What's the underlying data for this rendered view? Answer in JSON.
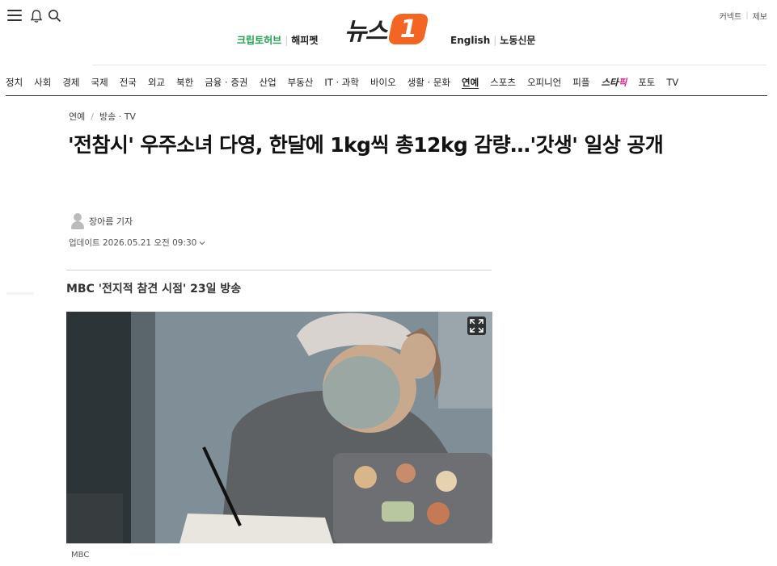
{
  "header": {
    "logo_text": "뉴스",
    "logo_badge": "1",
    "left_links": [
      "크립토허브",
      "해피펫"
    ],
    "right_links": [
      "English",
      "노동신문"
    ],
    "util_links": [
      "커넥트",
      "제보"
    ]
  },
  "gnb": {
    "items": [
      "정치",
      "사회",
      "경제",
      "국제",
      "전국",
      "외교",
      "북한",
      "금융 · 증권",
      "산업",
      "부동산",
      "IT · 과학",
      "바이오",
      "생활 · 문화",
      "연예",
      "스포츠",
      "오피니언",
      "피플",
      "스타픽",
      "포토",
      "TV"
    ],
    "active": "연예",
    "star_item": {
      "prefix": "스타",
      "suffix": "픽"
    }
  },
  "article": {
    "breadcrumb": [
      "연예",
      "방송 · TV"
    ],
    "headline": "'전참시' 우주소녀 다영, 한달에 1kg씩 총12kg 감량…'갓생' 일상 공개",
    "reporter": "장아름 기자",
    "updated": "업데이트 2026.05.21 오전 09:30",
    "subtitle": "MBC '전지적 참견 시점' 23일 방송",
    "photo_caption": "MBC"
  },
  "colors": {
    "brand_orange": "#f26522",
    "green_link": "#21a04a",
    "star_pink": "#e91e8c"
  },
  "icons": [
    "menu-icon",
    "bell-icon",
    "search-icon",
    "expand-icon",
    "chevron-down-icon",
    "reporter-avatar-icon"
  ]
}
